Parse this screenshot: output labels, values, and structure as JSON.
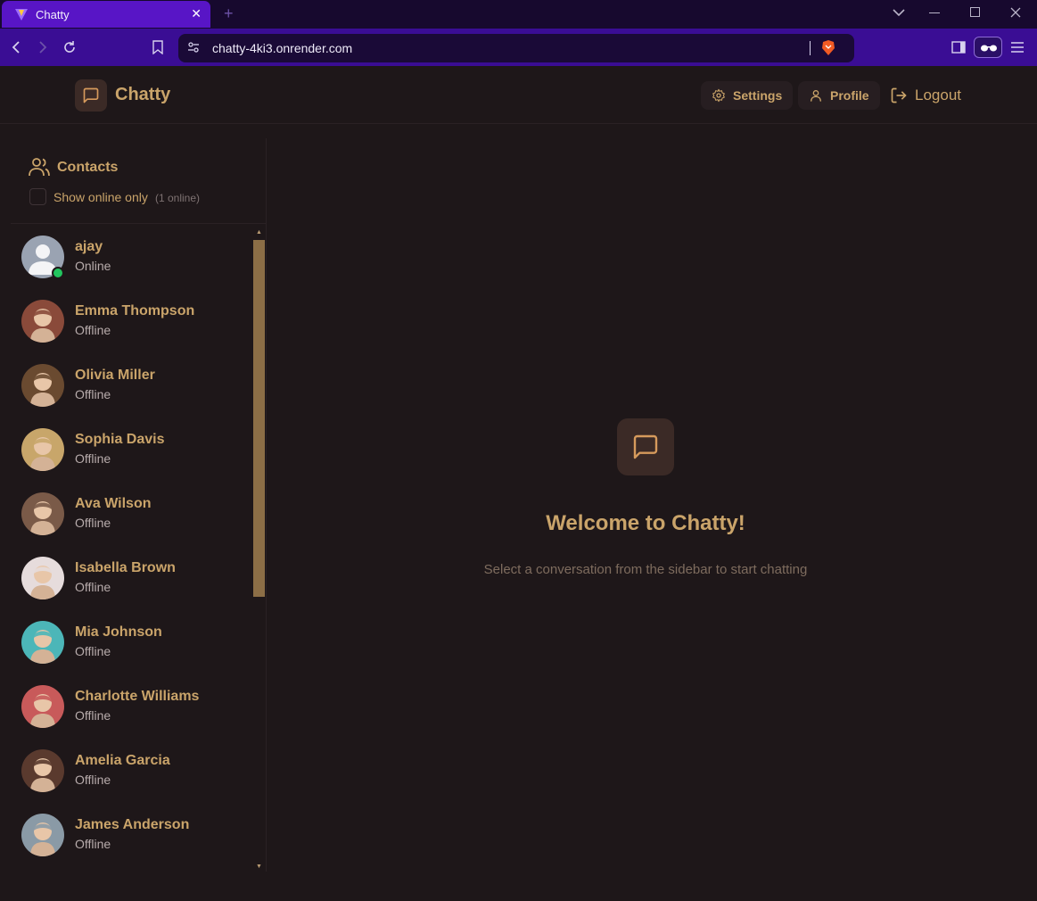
{
  "browser": {
    "tab_title": "Chatty",
    "url": "chatty-4ki3.onrender.com"
  },
  "header": {
    "brand": "Chatty",
    "settings_label": "Settings",
    "profile_label": "Profile",
    "logout_label": "Logout"
  },
  "sidebar": {
    "title": "Contacts",
    "filter_label": "Show online only",
    "online_count": "(1 online)",
    "contacts": [
      {
        "name": "ajay",
        "status": "Online",
        "avatar_color": "#9aa3b2"
      },
      {
        "name": "Emma Thompson",
        "status": "Offline",
        "avatar_color": "#8a4a3a"
      },
      {
        "name": "Olivia Miller",
        "status": "Offline",
        "avatar_color": "#6a4a30"
      },
      {
        "name": "Sophia Davis",
        "status": "Offline",
        "avatar_color": "#c8a66a"
      },
      {
        "name": "Ava Wilson",
        "status": "Offline",
        "avatar_color": "#7a5a48"
      },
      {
        "name": "Isabella Brown",
        "status": "Offline",
        "avatar_color": "#e6dcdc"
      },
      {
        "name": "Mia Johnson",
        "status": "Offline",
        "avatar_color": "#4cb6b8"
      },
      {
        "name": "Charlotte Williams",
        "status": "Offline",
        "avatar_color": "#c85a5a"
      },
      {
        "name": "Amelia Garcia",
        "status": "Offline",
        "avatar_color": "#5a3a2e"
      },
      {
        "name": "James Anderson",
        "status": "Offline",
        "avatar_color": "#8a9aa6"
      }
    ]
  },
  "main": {
    "welcome_title": "Welcome to Chatty!",
    "welcome_subtitle": "Select a conversation from the sidebar to start chatting"
  }
}
